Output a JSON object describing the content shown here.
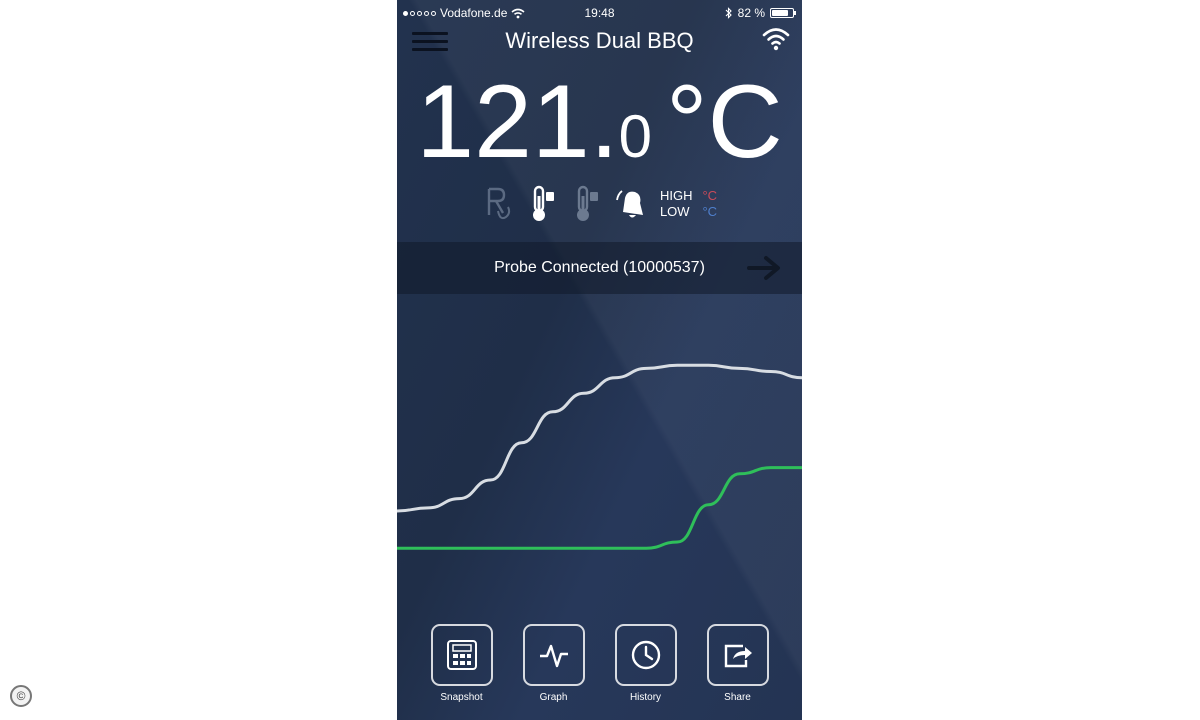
{
  "status_bar": {
    "carrier": "Vodafone.de",
    "time": "19:48",
    "battery": "82 %",
    "battery_level": 0.82,
    "signal_dots": 5,
    "signal_filled": 1
  },
  "header": {
    "title": "Wireless Dual BBQ"
  },
  "temperature": {
    "integer": "121.",
    "decimal": "0",
    "unit": "°C"
  },
  "alarm": {
    "high_label": "HIGH",
    "low_label": "LOW",
    "high_unit": "°C",
    "low_unit": "°C"
  },
  "probe": {
    "status": "Probe Connected (10000537)"
  },
  "graph": {
    "series": [
      {
        "color": "#d8dde3",
        "values": [
          0.3,
          0.31,
          0.34,
          0.4,
          0.52,
          0.62,
          0.68,
          0.73,
          0.76,
          0.77,
          0.77,
          0.76,
          0.75,
          0.73
        ]
      },
      {
        "color": "#2fbf5a",
        "values": [
          0.18,
          0.18,
          0.18,
          0.18,
          0.18,
          0.18,
          0.18,
          0.18,
          0.18,
          0.2,
          0.32,
          0.42,
          0.44,
          0.44
        ]
      }
    ]
  },
  "nav": {
    "snapshot": "Snapshot",
    "graph": "Graph",
    "history": "History",
    "share": "Share"
  },
  "colors": {
    "background": "#22324e",
    "alarm_high": "#c94b5a",
    "alarm_low": "#4f7fcc"
  }
}
